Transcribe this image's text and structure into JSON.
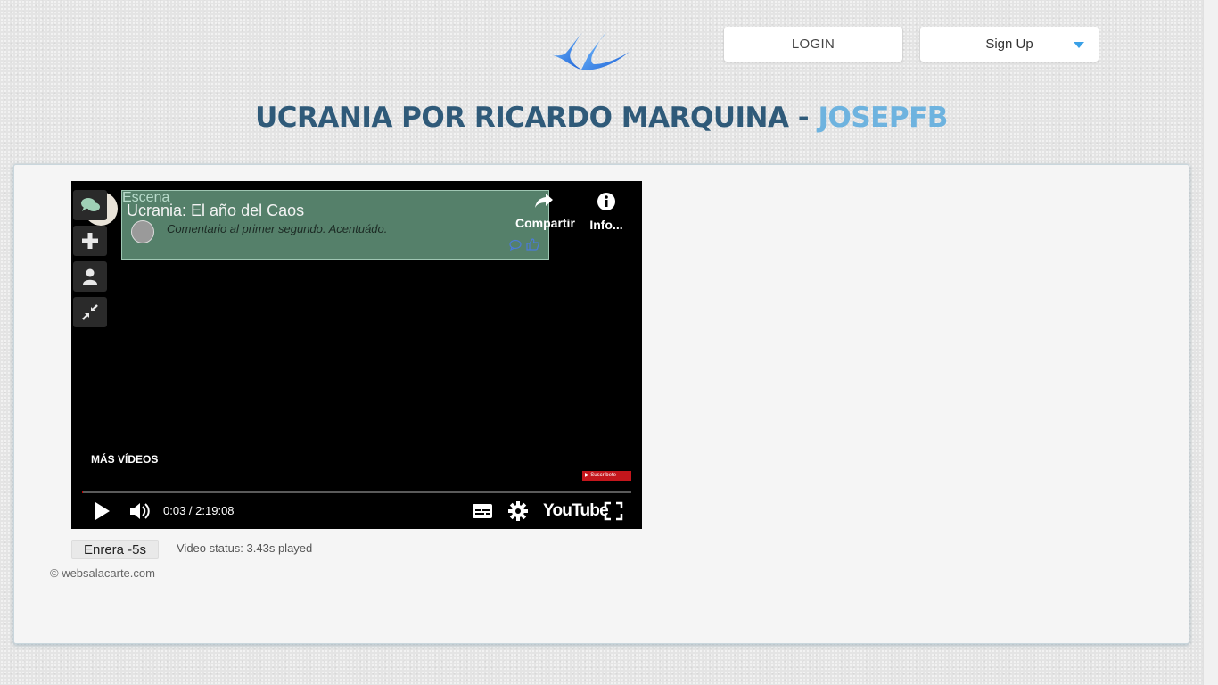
{
  "header": {
    "login_label": "LOGIN",
    "signup_label": "Sign Up",
    "accent_color": "#3aa0e6"
  },
  "page": {
    "title_part": "UCRANIA POR RICARDO MARQUINA",
    "title_separator": " - ",
    "title_user": "JOSEPFB"
  },
  "player": {
    "overlay_scene": "Escena",
    "video_title": "Ucrania: El año del Caos",
    "comment": "Comentario al primer segundo. Acentuádo.",
    "share_label": "Compartir",
    "info_label": "Info...",
    "more_videos": "MÁS VÍDEOS",
    "subscribe_label": "Suscríbete",
    "time_current": "0:03",
    "time_separator": " / ",
    "time_total": "2:19:08",
    "progress_fraction": 0.0004,
    "youtube_label": "YouTube",
    "side_icons": [
      "comments-icon",
      "plus-icon",
      "user-icon",
      "collapse-icon"
    ]
  },
  "controls": {
    "back_label": "Enrera -5s",
    "status_text": "Video status: 3.43s played"
  },
  "footer": {
    "copyright": "© websalacarte.com"
  }
}
